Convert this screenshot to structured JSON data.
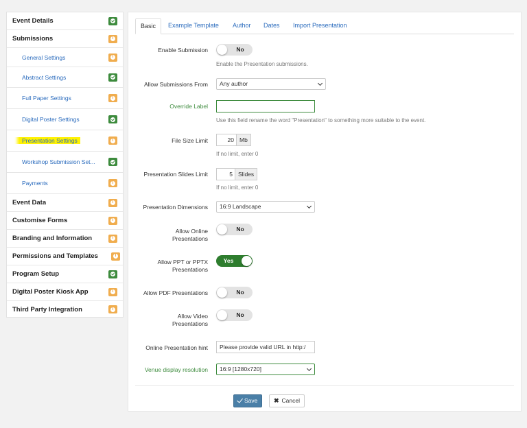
{
  "sidebar": {
    "items": [
      {
        "label": "Event Details",
        "status": "ok"
      },
      {
        "label": "Submissions",
        "status": "warn"
      },
      {
        "label": "General Settings",
        "status": "warn"
      },
      {
        "label": "Abstract Settings",
        "status": "ok"
      },
      {
        "label": "Full Paper Settings",
        "status": "warn"
      },
      {
        "label": "Digital Poster Settings",
        "status": "ok"
      },
      {
        "label": "Presentation Settings",
        "status": "warn"
      },
      {
        "label": "Workshop Submission Set...",
        "status": "ok"
      },
      {
        "label": "Payments",
        "status": "warn"
      },
      {
        "label": "Event Data",
        "status": "warn"
      },
      {
        "label": "Customise Forms",
        "status": "warn"
      },
      {
        "label": "Branding and Information",
        "status": "warn"
      },
      {
        "label": "Permissions and Templates",
        "status": "warn"
      },
      {
        "label": "Program Setup",
        "status": "ok"
      },
      {
        "label": "Digital Poster Kiosk App",
        "status": "warn"
      },
      {
        "label": "Third Party Integration",
        "status": "warn"
      }
    ]
  },
  "tabs": [
    "Basic",
    "Example Template",
    "Author",
    "Dates",
    "Import Presentation"
  ],
  "form": {
    "enable_submission": {
      "label": "Enable Submission",
      "value": "No",
      "help": "Enable the Presentation submissions."
    },
    "allow_from": {
      "label": "Allow Submissions From",
      "value": "Any author"
    },
    "override_label": {
      "label": "Override Label",
      "value": "",
      "help": "Use this field rename the word \"Presentation\" to something more suitable to the event."
    },
    "file_size": {
      "label": "File Size Limit",
      "value": "20",
      "unit": "Mb",
      "help": "If no limit, enter 0"
    },
    "slides_limit": {
      "label": "Presentation Slides Limit",
      "value": "5",
      "unit": "Slides",
      "help": "If no limit, enter 0"
    },
    "dimensions": {
      "label": "Presentation Dimensions",
      "value": "16:9 Landscape"
    },
    "allow_online": {
      "label": "Allow Online Presentations",
      "value": "No"
    },
    "allow_ppt": {
      "label": "Allow PPT or PPTX Presentations",
      "value": "Yes"
    },
    "allow_pdf": {
      "label": "Allow PDF Presentations",
      "value": "No"
    },
    "allow_video": {
      "label": "Allow Video Presentations",
      "value": "No"
    },
    "online_hint": {
      "label": "Online Presentation hint",
      "value": "Please provide valid URL in http:/"
    },
    "venue_resolution": {
      "label": "Venue display resolution",
      "value": "16:9 [1280x720]"
    }
  },
  "buttons": {
    "save": "Save",
    "cancel": "Cancel"
  },
  "colors": {
    "accent": "#2a6bbd",
    "ok": "#3d8b3d",
    "warn": "#f0ad4e",
    "highlight": "#fff200"
  }
}
